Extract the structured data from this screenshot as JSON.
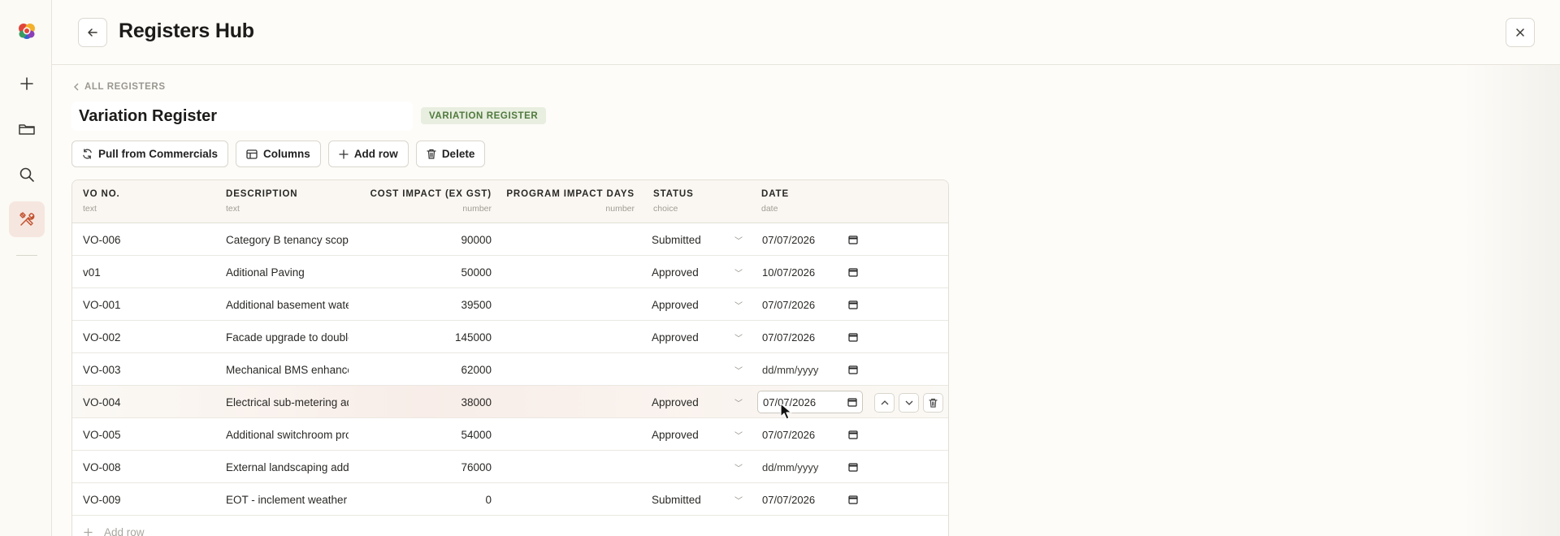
{
  "header": {
    "title": "Registers Hub"
  },
  "breadcrumb": {
    "label": "ALL REGISTERS"
  },
  "register": {
    "name": "Variation Register",
    "type_badge": "VARIATION REGISTER"
  },
  "toolbar": {
    "pull_label": "Pull from Commercials",
    "columns_label": "Columns",
    "add_row_label": "Add row",
    "delete_label": "Delete"
  },
  "table": {
    "columns": [
      {
        "title": "VO NO.",
        "type": "text"
      },
      {
        "title": "DESCRIPTION",
        "type": "text"
      },
      {
        "title": "COST IMPACT (EX GST)",
        "type": "number"
      },
      {
        "title": "PROGRAM IMPACT DAYS",
        "type": "number"
      },
      {
        "title": "STATUS",
        "type": "choice"
      },
      {
        "title": "DATE",
        "type": "date"
      }
    ],
    "rows": [
      {
        "vo": "VO-006",
        "desc": "Category B tenancy scope",
        "cost": "90000",
        "days": "",
        "status": "Submitted",
        "date": "07/07/2026"
      },
      {
        "vo": "v01",
        "desc": "Aditional Paving",
        "cost": "50000",
        "days": "",
        "status": "Approved",
        "date": "10/07/2026"
      },
      {
        "vo": "VO-001",
        "desc": "Additional basement water",
        "cost": "39500",
        "days": "",
        "status": "Approved",
        "date": "07/07/2026"
      },
      {
        "vo": "VO-002",
        "desc": "Facade upgrade to double",
        "cost": "145000",
        "days": "",
        "status": "Approved",
        "date": "07/07/2026"
      },
      {
        "vo": "VO-003",
        "desc": "Mechanical BMS enhance",
        "cost": "62000",
        "days": "",
        "status": "",
        "date": "dd/mm/yyyy"
      },
      {
        "vo": "VO-004",
        "desc": "Electrical sub-metering ad",
        "cost": "38000",
        "days": "",
        "status": "Approved",
        "date": "07/07/2026"
      },
      {
        "vo": "VO-005",
        "desc": "Additional switchroom pro",
        "cost": "54000",
        "days": "",
        "status": "Approved",
        "date": "07/07/2026"
      },
      {
        "vo": "VO-008",
        "desc": "External landscaping addi",
        "cost": "76000",
        "days": "",
        "status": "",
        "date": "dd/mm/yyyy"
      },
      {
        "vo": "VO-009",
        "desc": "EOT - inclement weather (",
        "cost": "0",
        "days": "",
        "status": "Submitted",
        "date": "07/07/2026"
      }
    ],
    "add_row_label": "Add row"
  },
  "icons": {
    "back": "arrow-left-icon",
    "close": "close-icon",
    "sidebar": [
      "plus-icon",
      "folder-icon",
      "search-icon",
      "tools-icon"
    ]
  },
  "colors": {
    "accent": "#c2522e",
    "badge_bg": "#e8eee0",
    "badge_text": "#4f7a3d"
  }
}
